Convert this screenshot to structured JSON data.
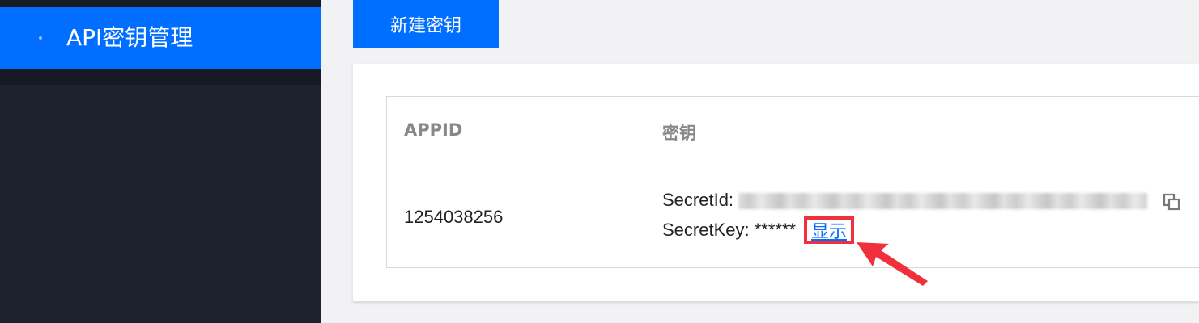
{
  "sidebar": {
    "active_item": {
      "label": "API密钥管理"
    }
  },
  "toolbar": {
    "new_key_label": "新建密钥"
  },
  "table": {
    "columns": [
      "APPID",
      "密钥"
    ],
    "rows": [
      {
        "appid": "1254038256",
        "secret_id_label": "SecretId:",
        "secret_key_label": "SecretKey:",
        "secret_key_masked": "******",
        "show_label": "显示"
      }
    ]
  },
  "colors": {
    "brand_blue": "#006eff",
    "sidebar_bg": "#1e222d",
    "annotation_red": "#f0303a"
  },
  "icons": {
    "copy": "copy-icon",
    "bullet": "dot-icon",
    "annotation": "arrow-annotation"
  }
}
